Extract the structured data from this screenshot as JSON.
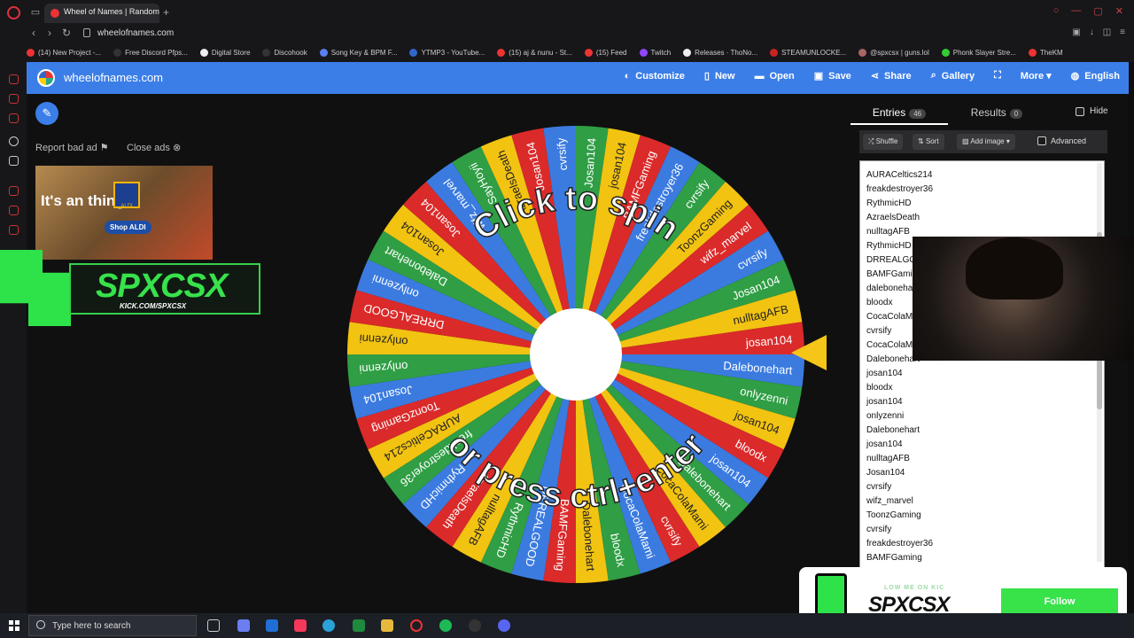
{
  "browser": {
    "active_tab_title": "Wheel of Names | Random",
    "url": "wheelofnames.com",
    "bookmarks": [
      {
        "label": "(14) New Project -...",
        "color": "#e33"
      },
      {
        "label": "Free Discord Pfps...",
        "color": "#333"
      },
      {
        "label": "Digital Store",
        "color": "#eee"
      },
      {
        "label": "Discohook",
        "color": "#333"
      },
      {
        "label": "Song Key & BPM F...",
        "color": "#5b7ef0"
      },
      {
        "label": "YTMP3 - YouTube...",
        "color": "#36c"
      },
      {
        "label": "(15) aj & nunu - St...",
        "color": "#e33"
      },
      {
        "label": "(15) Feed",
        "color": "#e33"
      },
      {
        "label": "Twitch",
        "color": "#9146ff"
      },
      {
        "label": "Releases · ThoNo...",
        "color": "#eee"
      },
      {
        "label": "STEAMUNLOCKE...",
        "color": "#c22"
      },
      {
        "label": "@spxcsx | guns.lol",
        "color": "#a66"
      },
      {
        "label": "Phonk Slayer Stre...",
        "color": "#3c3"
      },
      {
        "label": "TheKM",
        "color": "#e33"
      }
    ]
  },
  "site": {
    "name": "wheelofnames.com",
    "nav": [
      {
        "label": "Customize",
        "icon": "palette-icon",
        "glyph": "◐"
      },
      {
        "label": "New",
        "icon": "new-file-icon",
        "glyph": "▯"
      },
      {
        "label": "Open",
        "icon": "folder-icon",
        "glyph": "▬"
      },
      {
        "label": "Save",
        "icon": "save-icon",
        "glyph": "▣"
      },
      {
        "label": "Share",
        "icon": "share-icon",
        "glyph": "⋖"
      },
      {
        "label": "Gallery",
        "icon": "search-icon",
        "glyph": "⌕"
      },
      {
        "label": "",
        "icon": "fullscreen-icon",
        "glyph": "⛶"
      },
      {
        "label": "More ▾",
        "icon": "more-icon",
        "glyph": ""
      },
      {
        "label": "English",
        "icon": "globe-icon",
        "glyph": "◍"
      }
    ],
    "accent": "#3c7ee8"
  },
  "ads": {
    "report_label": "Report bad ad",
    "close_label": "Close ads",
    "ad_text": "It's an    thing.",
    "ad_button": "Shop ALDI",
    "ad_brand": "ALDI"
  },
  "overlay": {
    "streamer_name": "SPXCSX",
    "streamer_sub": "KICK.COM/SPXCSX",
    "follow_small": "LOW ME ON KIC",
    "follow_name": "SPXCSX",
    "follow_button": "Follow"
  },
  "wheel": {
    "top_text": "Click to spin",
    "bottom_text": "or press ctrl+enter",
    "colors": [
      "#2f9e44",
      "#f2c311",
      "#db2a2a",
      "#3b7be0"
    ],
    "segments": [
      "Josan104",
      "josan104",
      "BAMFGaming",
      "freakdestroyer36",
      "cvrsify",
      "ToonzGaming",
      "wifz_marvel",
      "cvrsify",
      "Josan104",
      "nulltagAFB",
      "josan104",
      "Dalebonehart",
      "onlyzenni",
      "josan104",
      "bloodx",
      "josan104",
      "Dalebonehart",
      "CocaColaMami",
      "cvrsify",
      "CocaColaMami",
      "bloodx",
      "Dalebonehart",
      "BAMFGaming",
      "DRREALGOOD",
      "RythmicHD",
      "nulltagAFB",
      "AzraelsDeath",
      "RythmicHD",
      "freakdestroyer36",
      "AURACeltics214",
      "ToonzGaming",
      "Josan104",
      "onlyzenni",
      "onlyzenni",
      "DRREALGOOD",
      "onlyzenni",
      "Dalebonehart",
      "Josan104",
      "Josan104",
      "wifz_marvel",
      "SayHoyii",
      "AzraelsDeath",
      "Josan104",
      "cvrsify"
    ]
  },
  "panel": {
    "entries_tab": "Entries",
    "entries_count": "46",
    "results_tab": "Results",
    "results_count": "0",
    "hide_label": "Hide",
    "shuffle_label": "Shuffle",
    "sort_label": "Sort",
    "add_image_label": "Add image",
    "advanced_label": "Advanced",
    "entries": [
      "AURACeltics214",
      "freakdestroyer36",
      "RythmicHD",
      "AzraelsDeath",
      "nulltagAFB",
      "RythmicHD",
      "DRREALGO",
      "BAMFGami",
      "dalebonehart",
      "bloodx",
      "CocaColaM",
      "cvrsify",
      "CocaColaM",
      "Dalebonehart",
      "josan104",
      "bloodx",
      "josan104",
      "onlyzenni",
      "Dalebonehart",
      "josan104",
      "nulltagAFB",
      "Josan104",
      "cvrsify",
      "wifz_marvel",
      "ToonzGaming",
      "cvrsify",
      "freakdestroyer36",
      "BAMFGaming"
    ]
  },
  "taskbar": {
    "search_placeholder": "Type here to search"
  }
}
